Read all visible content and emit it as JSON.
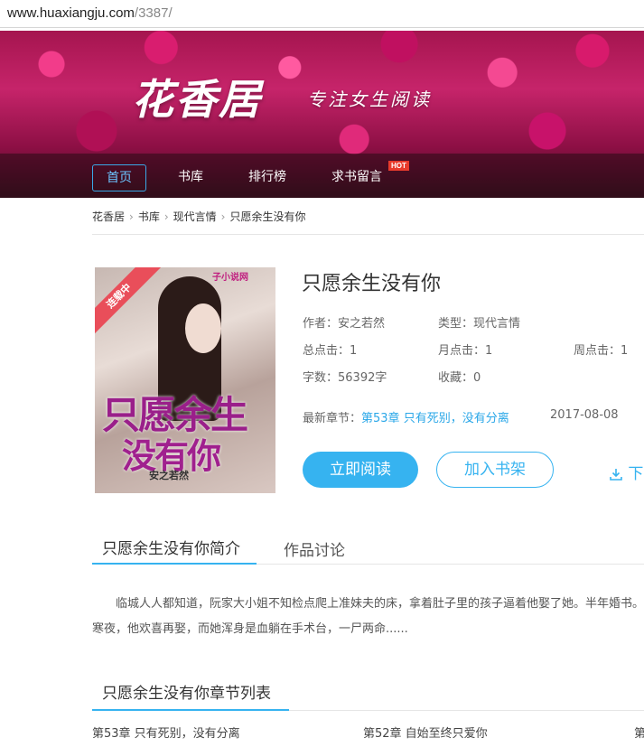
{
  "browser": {
    "url_host": "www.huaxiangju.com",
    "url_path": "/3387/"
  },
  "site": {
    "logo_text": "花香居",
    "slogan": "专注女生阅读"
  },
  "nav": {
    "items": [
      "首页",
      "书库",
      "排行榜",
      "求书留言"
    ],
    "hot_badge": "HOT"
  },
  "breadcrumb": [
    "花香居",
    "书库",
    "现代言情",
    "只愿余生没有你"
  ],
  "book": {
    "title": "只愿余生没有你",
    "status_ribbon": "连载中",
    "cover": {
      "title_line1": "只愿余生",
      "title_line2": "没有你",
      "author_mark": "安之若然",
      "site_mark": "子小说网"
    },
    "author_label": "作者：安之若然",
    "type_label": "类型：现代言情",
    "total_clicks": "总点击：1",
    "monthly_clicks": "月点击：1",
    "weekly_clicks": "周点击：1",
    "word_count": "字数：56392字",
    "favorites": "收藏：0",
    "latest_label": "最新章节：",
    "latest_chapter": "第53章 只有死别，没有分离",
    "latest_date": "2017-08-08",
    "read_button": "立即阅读",
    "shelf_button": "加入书架",
    "download_label": "下"
  },
  "tabs": {
    "intro_tab": "只愿余生没有你简介",
    "discussion_tab": "作品讨论"
  },
  "intro_text": "临城人人都知道，阮家大小姐不知检点爬上准妹夫的床，拿着肚子里的孩子逼着他娶了她。半年婚书。深冬寒夜，他欢喜再娶，而她浑身是血躺在手术台，一尸两命......",
  "chapters": {
    "heading": "只愿余生没有你章节列表",
    "items": [
      "第53章 只有死别，没有分离",
      "第52章 自始至终只爱你",
      "第"
    ]
  },
  "colors": {
    "accent": "#36b3f0",
    "hot": "#e83b2c",
    "ribbon": "#e94e5a"
  }
}
